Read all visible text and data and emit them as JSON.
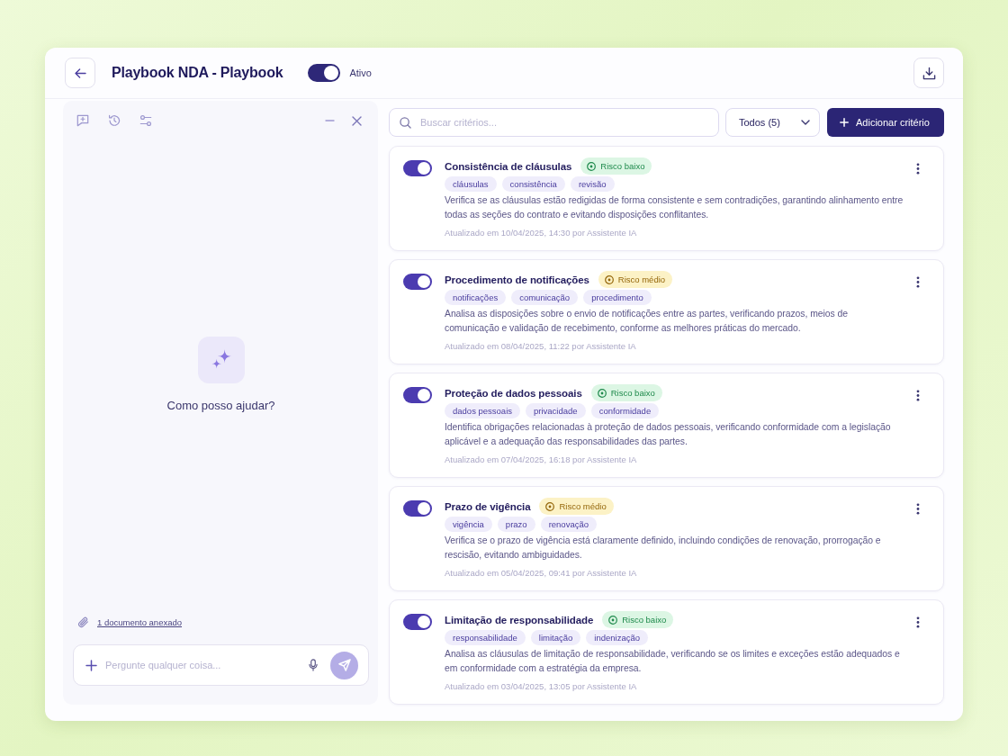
{
  "header": {
    "title": "Playbook NDA - Playbook",
    "status_toggle": {
      "label": "Ativo",
      "on": true
    }
  },
  "assistant_panel": {
    "prompt": "Como posso ajudar?",
    "attachment": "1 documento anexado",
    "input": {
      "placeholder": "Pergunte qualquer coisa..."
    }
  },
  "toolbar": {
    "search": {
      "placeholder": "Buscar critérios..."
    },
    "filter": "Todos (5)",
    "add_button": "Adicionar critério"
  },
  "criteria": [
    {
      "title": "Consistência de cláusulas",
      "on": true,
      "risk": {
        "label": "Risco baixo",
        "kind": "low"
      },
      "tags": [
        "cláusulas",
        "consistência",
        "revisão"
      ],
      "description": "Verifica se as cláusulas estão redigidas de forma consistente e sem contradições, garantindo alinhamento entre todas as seções do contrato e evitando disposições conflitantes.",
      "updated": "Atualizado em 10/04/2025, 14:30 por Assistente IA"
    },
    {
      "title": "Procedimento de notificações",
      "on": true,
      "risk": {
        "label": "Risco médio",
        "kind": "medium"
      },
      "tags": [
        "notificações",
        "comunicação",
        "procedimento"
      ],
      "description": "Analisa as disposições sobre o envio de notificações entre as partes, verificando prazos, meios de comunicação e validação de recebimento, conforme as melhores práticas do mercado.",
      "updated": "Atualizado em 08/04/2025, 11:22 por Assistente IA"
    },
    {
      "title": "Proteção de dados pessoais",
      "on": true,
      "risk": {
        "label": "Risco baixo",
        "kind": "low"
      },
      "tags": [
        "dados pessoais",
        "privacidade",
        "conformidade"
      ],
      "description": "Identifica obrigações relacionadas à proteção de dados pessoais, verificando conformidade com a legislação aplicável e a adequação das responsabilidades das partes.",
      "updated": "Atualizado em 07/04/2025, 16:18 por Assistente IA"
    },
    {
      "title": "Prazo de vigência",
      "on": true,
      "risk": {
        "label": "Risco médio",
        "kind": "medium"
      },
      "tags": [
        "vigência",
        "prazo",
        "renovação"
      ],
      "description": "Verifica se o prazo de vigência está claramente definido, incluindo condições de renovação, prorrogação e rescisão, evitando ambiguidades.",
      "updated": "Atualizado em 05/04/2025, 09:41 por Assistente IA"
    },
    {
      "title": "Limitação de responsabilidade",
      "on": true,
      "risk": {
        "label": "Risco baixo",
        "kind": "low"
      },
      "tags": [
        "responsabilidade",
        "limitação",
        "indenização"
      ],
      "description": "Analisa as cláusulas de limitação de responsabilidade, verificando se os limites e exceções estão adequados e em conformidade com a estratégia da empresa.",
      "updated": "Atualizado em 03/04/2025, 13:05 por Assistente IA"
    }
  ]
}
